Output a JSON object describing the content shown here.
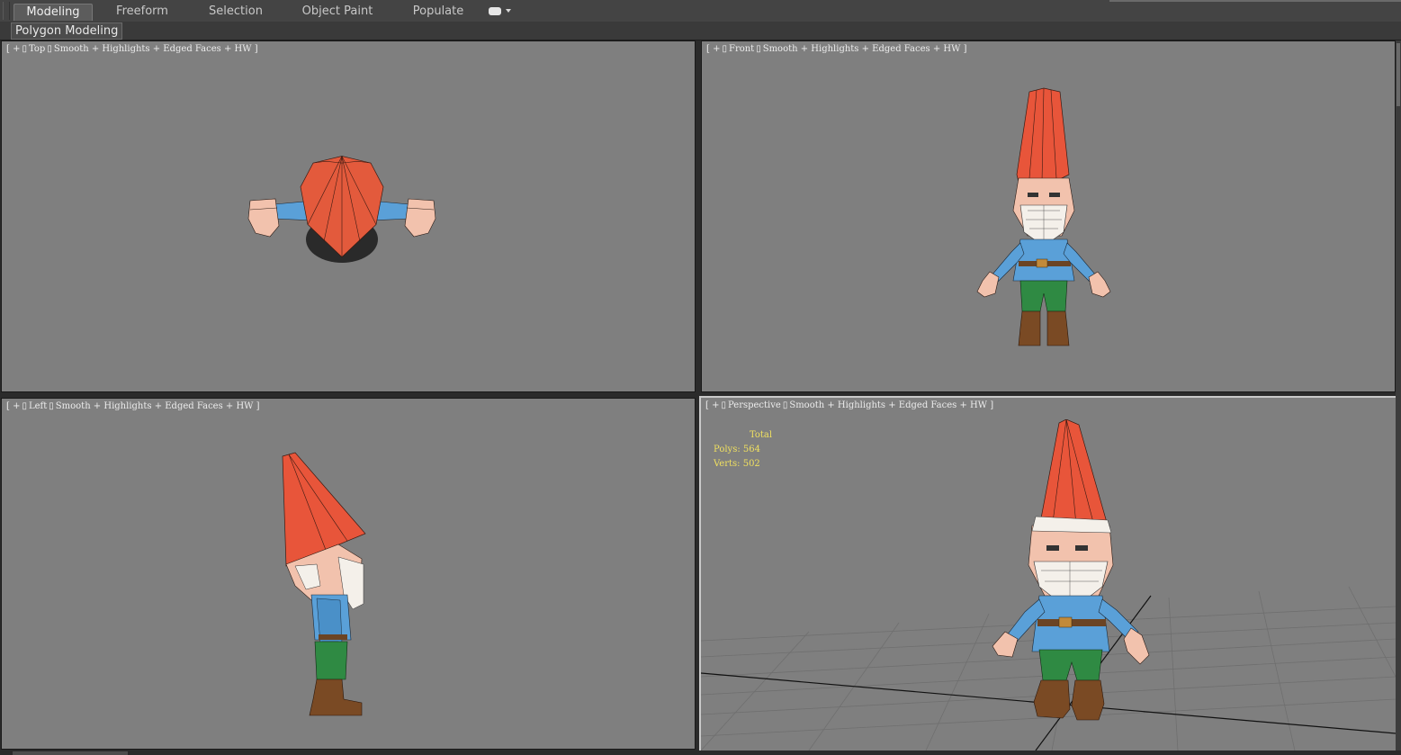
{
  "ribbon": {
    "tabs": [
      {
        "label": "Modeling",
        "active": true
      },
      {
        "label": "Freeform",
        "active": false
      },
      {
        "label": "Selection",
        "active": false
      },
      {
        "label": "Object Paint",
        "active": false
      },
      {
        "label": "Populate",
        "active": false
      }
    ],
    "more_icon": "toggle-switch-icon"
  },
  "panel": {
    "label": "Polygon Modeling"
  },
  "viewports": {
    "top": {
      "plus": "+",
      "view": "Top",
      "shading": "Smooth + Highlights + Edged Faces + HW"
    },
    "front": {
      "plus": "+",
      "view": "Front",
      "shading": "Smooth + Highlights + Edged Faces + HW"
    },
    "left": {
      "plus": "+",
      "view": "Left",
      "shading": "Smooth + Highlights + Edged Faces + HW"
    },
    "perspective": {
      "plus": "+",
      "view": "Perspective",
      "shading": "Smooth + Highlights + Edged Faces + HW",
      "stats": {
        "title": "Total",
        "polys": "Polys: 564",
        "verts": "Verts: 502"
      }
    }
  },
  "colors": {
    "viewport_bg": "#7f7f7f",
    "hat": "#e8553a",
    "shirt": "#5aa0d8",
    "pants": "#2f8a43",
    "boots": "#7a4a24",
    "skin": "#f2c2ad",
    "beard": "#f4f0ea",
    "stats_text": "#f0e060"
  }
}
